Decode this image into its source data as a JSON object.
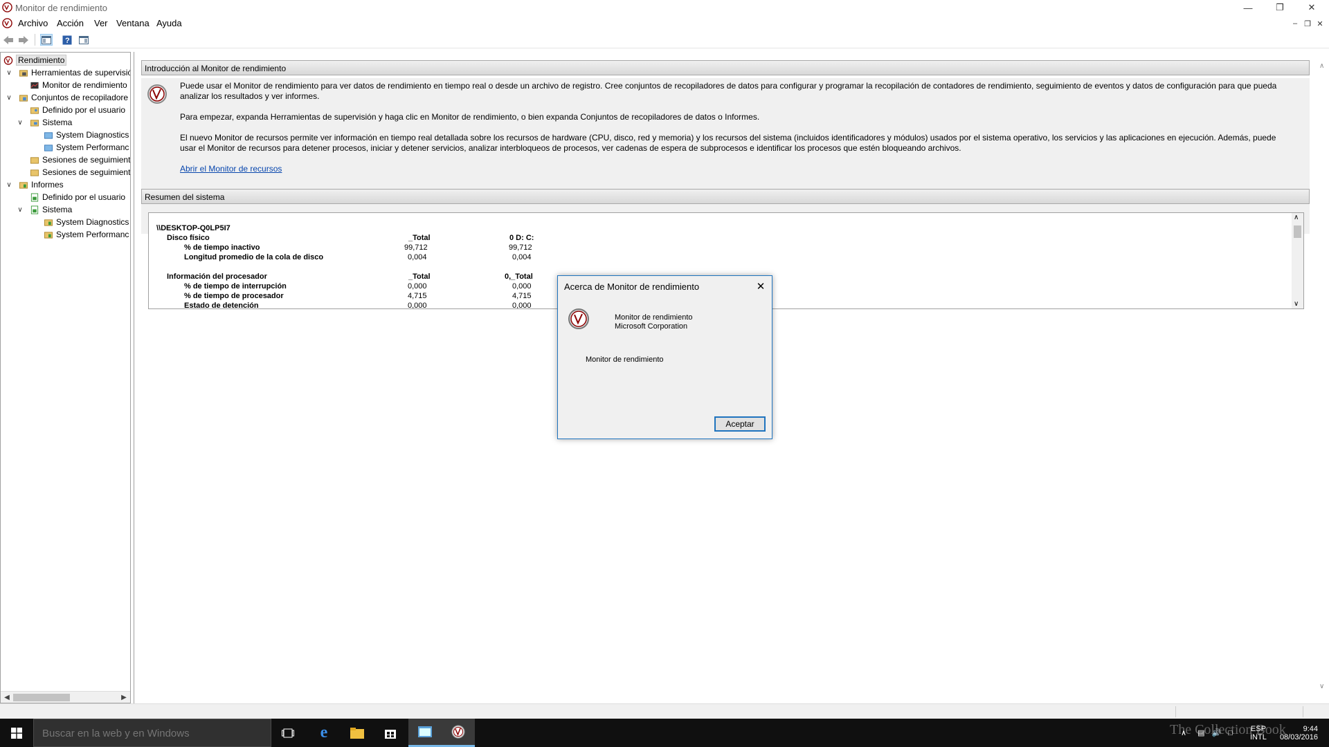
{
  "window": {
    "title": "Monitor de rendimiento"
  },
  "menu": [
    "Archivo",
    "Acción",
    "Ver",
    "Ventana",
    "Ayuda"
  ],
  "tree": {
    "root": "Rendimiento",
    "items": [
      "Herramientas de supervisió",
      "Monitor de rendimiento",
      "Conjuntos de recopiladore",
      "Definido por el usuario",
      "Sistema",
      "System Diagnostics",
      "System Performanc",
      "Sesiones de seguimient",
      "Sesiones de seguimient",
      "Informes",
      "Definido por el usuario",
      "Sistema",
      "System Diagnostics",
      "System Performanc"
    ]
  },
  "intro": {
    "header": "Introducción al Monitor de rendimiento",
    "p1": "Puede usar el Monitor de rendimiento para ver datos de rendimiento en tiempo real o desde un archivo de registro. Cree conjuntos de recopiladores de datos para configurar y programar la recopilación de contadores de rendimiento, seguimiento de eventos y datos de configuración para que pueda analizar los resultados y ver informes.",
    "p2": "Para empezar, expanda Herramientas de supervisión y haga clic en Monitor de rendimiento, o bien expanda Conjuntos de recopiladores de datos o Informes.",
    "p3": "El nuevo Monitor de recursos permite ver información en tiempo real detallada sobre los recursos de hardware (CPU, disco, red y memoria) y los recursos del sistema (incluidos identificadores y módulos) usados por el sistema operativo, los servicios y las aplicaciones en ejecución. Además, puede usar el Monitor de recursos para detener procesos, iniciar y detener servicios, analizar interbloqueos de procesos, ver cadenas de espera de subprocesos e identificar los procesos que estén bloqueando archivos.",
    "link": "Abrir el Monitor de recursos"
  },
  "summary": {
    "header": "Resumen del sistema",
    "machine": "\\\\DESKTOP-Q0LP5I7",
    "disk_group": "Disco físico",
    "disk_col1": "_Total",
    "disk_col2": "0 D: C:",
    "disk_rows": [
      {
        "label": "% de tiempo inactivo",
        "v1": "99,712",
        "v2": "99,712"
      },
      {
        "label": "Longitud promedio de la cola de disco",
        "v1": "0,004",
        "v2": "0,004"
      }
    ],
    "cpu_group": "Información del procesador",
    "cpu_col1": "_Total",
    "cpu_col2": "0,_Total",
    "cpu_rows": [
      {
        "label": "% de tiempo de interrupción",
        "v1": "0,000",
        "v2": "0,000"
      },
      {
        "label": "% de tiempo de procesador",
        "v1": "4,715",
        "v2": "4,715"
      },
      {
        "label": "Estado de detención",
        "v1": "0,000",
        "v2": "0,000"
      }
    ]
  },
  "dialog": {
    "title": "Acerca de Monitor de rendimiento",
    "line1": "Monitor de rendimiento",
    "line2": "Microsoft Corporation",
    "line3": "Monitor de rendimiento",
    "ok": "Aceptar"
  },
  "taskbar": {
    "search_placeholder": "Buscar en la web y en Windows",
    "lang": "ESP",
    "layout": "INTL",
    "time": "9:44",
    "date": "08/03/2016",
    "watermark": "The Collection Book"
  },
  "colors": {
    "accent": "#1e73be",
    "taskbar": "#101010",
    "link": "#0645ad"
  }
}
